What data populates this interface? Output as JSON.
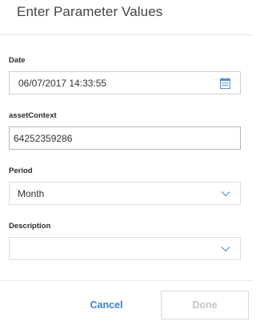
{
  "dialog": {
    "title": "Enter Parameter Values"
  },
  "fields": {
    "date": {
      "label": "Date",
      "value": "06/07/2017 14:33:55",
      "icon": "calendar-icon"
    },
    "asset_context": {
      "label": "assetContext",
      "value": "64252359286"
    },
    "period": {
      "label": "Period",
      "value": "Month",
      "icon": "chevron-down-icon"
    },
    "description": {
      "label": "Description",
      "value": "",
      "icon": "chevron-down-icon"
    }
  },
  "buttons": {
    "cancel_label": "Cancel",
    "done_label": "Done"
  },
  "colors": {
    "accent": "#3a7fd0",
    "disabled_text": "#c4c4c4",
    "icon": "#5b8fc9"
  }
}
